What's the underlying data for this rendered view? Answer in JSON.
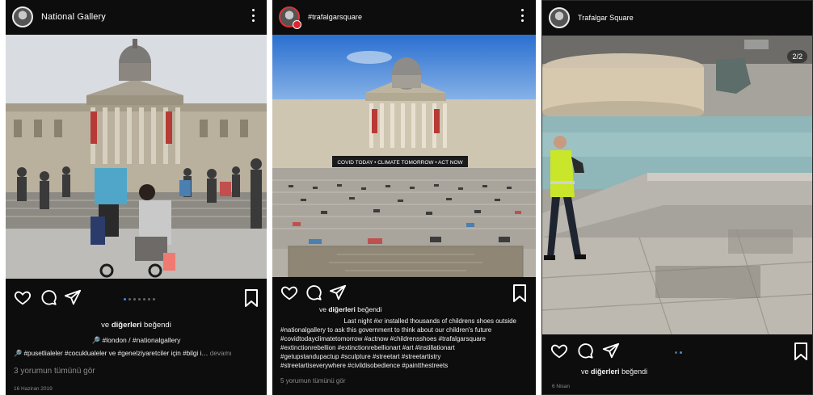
{
  "posts": [
    {
      "username": "National Gallery",
      "liked_by": "ve",
      "liked_bold": "diğerleri",
      "liked_suffix": "beğendi",
      "caption_line1": "🔎 #london / #nationalgallery",
      "caption_line2": "🔎 #pusetlialeler #cocuklualeler ve #genelziyaretciler için #bilgi i…",
      "caption_more": "devamı",
      "comments_link": "3 yorumun tümünü gör",
      "date": "16 Haziran 2019",
      "carousel_total": 7,
      "carousel_active": 1
    },
    {
      "username": "#trafalgarsquare",
      "liked_by": "ve",
      "liked_bold": "diğerleri",
      "liked_suffix": "beğendi",
      "caption_lines": [
        "Last night #xr installed thousands  of childrens shoes outside",
        "#nationalgallery to ask this government to think about our children's future",
        "#covidtodayclimatetomorrow #actnow  #childrensshoes #trafalgarsquare",
        "#extinctionrebellion #extinctionrebellionart  #art #instillationart",
        "#getupstandupactup #sculpture #streetart #streetartistry",
        "#streetartiseverywhere #civildisobedience #paintthestreets"
      ],
      "comments_link": "5 yorumun tümünü gör",
      "banner_text": "COVID TODAY • CLIMATE TOMORROW • ACT NOW"
    },
    {
      "username": "Trafalgar Square",
      "counter": "2/2",
      "liked_by": "ve",
      "liked_bold": "diğerleri",
      "liked_suffix": "beğendi",
      "date": "6 Nisan",
      "carousel_total": 2,
      "carousel_active": 2
    }
  ],
  "icons": [
    "heart-icon",
    "comment-icon",
    "share-icon",
    "bookmark-icon",
    "more-options-icon"
  ],
  "colors": {
    "background": "#0d0d0d",
    "carousel_active": "#3b8fe0",
    "muted_text": "#8b8b8b"
  }
}
